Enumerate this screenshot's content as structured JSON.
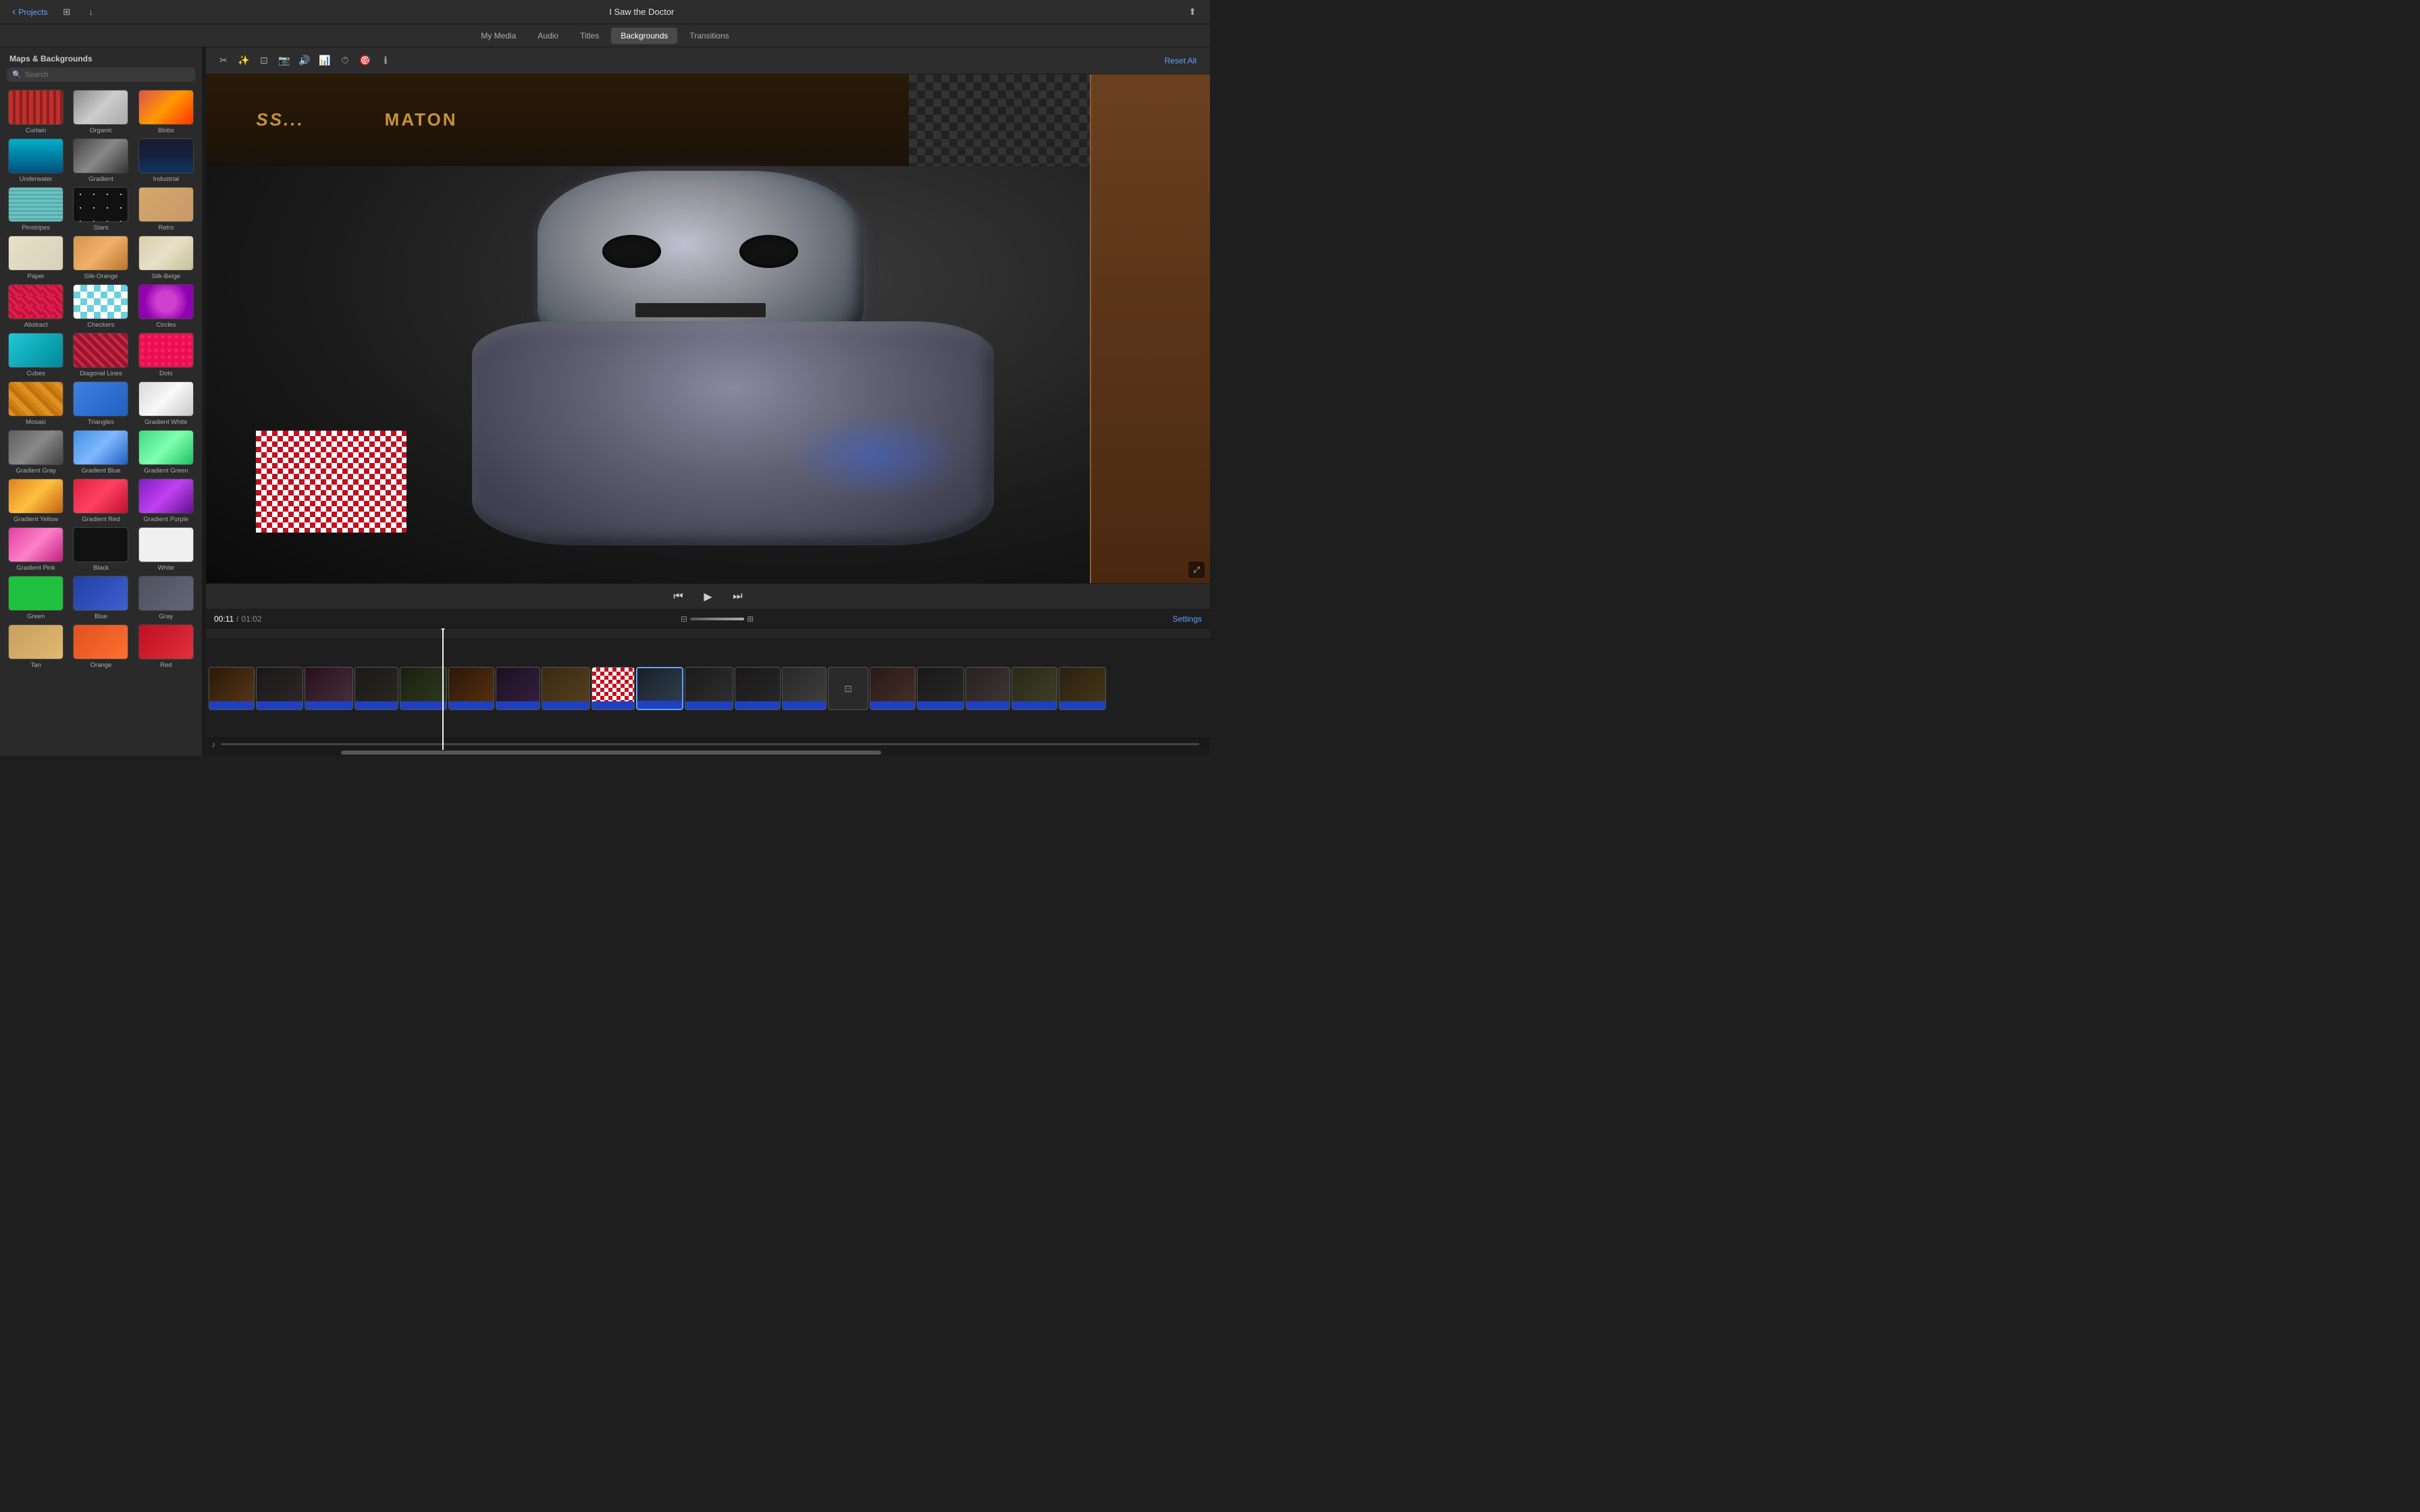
{
  "app": {
    "title": "I Saw the Doctor",
    "projects_label": "Projects"
  },
  "nav": {
    "tabs": [
      {
        "id": "my-media",
        "label": "My Media"
      },
      {
        "id": "audio",
        "label": "Audio"
      },
      {
        "id": "titles",
        "label": "Titles"
      },
      {
        "id": "backgrounds",
        "label": "Backgrounds"
      },
      {
        "id": "transitions",
        "label": "Transitions"
      }
    ],
    "active": "backgrounds"
  },
  "left_panel": {
    "title": "Maps & Backgrounds",
    "search": {
      "placeholder": "Search",
      "value": ""
    }
  },
  "backgrounds": [
    {
      "id": "curtain",
      "label": "Curtain",
      "class": "bg-curtain"
    },
    {
      "id": "organic",
      "label": "Organic",
      "class": "bg-organic"
    },
    {
      "id": "blobs",
      "label": "Blobs",
      "class": "bg-blobs"
    },
    {
      "id": "underwater",
      "label": "Underwater",
      "class": "bg-underwater"
    },
    {
      "id": "gradient",
      "label": "Gradient",
      "class": "bg-gradient"
    },
    {
      "id": "industrial",
      "label": "Industrial",
      "class": "bg-industrial"
    },
    {
      "id": "pinstripes",
      "label": "Pinstripes",
      "class": "bg-pinstripes"
    },
    {
      "id": "stars",
      "label": "Stars",
      "class": "bg-stars"
    },
    {
      "id": "retro",
      "label": "Retro",
      "class": "bg-retro"
    },
    {
      "id": "paper",
      "label": "Paper",
      "class": "bg-paper"
    },
    {
      "id": "silk-orange",
      "label": "Silk-Orange",
      "class": "bg-silk-orange"
    },
    {
      "id": "silk-beige",
      "label": "Silk-Beige",
      "class": "bg-silk-beige"
    },
    {
      "id": "abstract",
      "label": "Abstract",
      "class": "bg-abstract"
    },
    {
      "id": "checkers",
      "label": "Checkers",
      "class": "bg-checkers"
    },
    {
      "id": "circles",
      "label": "Circles",
      "class": "bg-circles"
    },
    {
      "id": "cubes",
      "label": "Cubes",
      "class": "bg-cubes-item"
    },
    {
      "id": "diagonal-lines",
      "label": "Diagonal Lines",
      "class": "bg-diagonal"
    },
    {
      "id": "dots",
      "label": "Dots",
      "class": "bg-dots"
    },
    {
      "id": "mosaic",
      "label": "Mosaic",
      "class": "bg-mosaic"
    },
    {
      "id": "triangles",
      "label": "Triangles",
      "class": "bg-triangles"
    },
    {
      "id": "gradient-white",
      "label": "Gradient White",
      "class": "bg-gradient-white"
    },
    {
      "id": "gradient-gray",
      "label": "Gradient Gray",
      "class": "bg-gradient-gray"
    },
    {
      "id": "gradient-blue",
      "label": "Gradient Blue",
      "class": "bg-gradient-blue"
    },
    {
      "id": "gradient-green",
      "label": "Gradient Green",
      "class": "bg-gradient-green"
    },
    {
      "id": "gradient-yellow",
      "label": "Gradient Yellow",
      "class": "bg-gradient-yellow"
    },
    {
      "id": "gradient-red",
      "label": "Gradient Red",
      "class": "bg-gradient-red"
    },
    {
      "id": "gradient-purple",
      "label": "Gradient Purple",
      "class": "bg-gradient-purple"
    },
    {
      "id": "gradient-pink",
      "label": "Gradient Pink",
      "class": "bg-gradient-pink"
    },
    {
      "id": "black",
      "label": "Black",
      "class": "bg-black"
    },
    {
      "id": "white",
      "label": "White",
      "class": "bg-white"
    },
    {
      "id": "green",
      "label": "Green",
      "class": "bg-green"
    },
    {
      "id": "blue",
      "label": "Blue",
      "class": "bg-blue"
    },
    {
      "id": "gray",
      "label": "Gray",
      "class": "bg-gray"
    },
    {
      "id": "tan",
      "label": "Tan",
      "class": "bg-tan"
    },
    {
      "id": "orange",
      "label": "Orange",
      "class": "bg-orange"
    },
    {
      "id": "red",
      "label": "Red",
      "class": "bg-red"
    }
  ],
  "toolbar": {
    "reset_label": "Reset All"
  },
  "player": {
    "time_current": "00:11",
    "time_separator": "/",
    "time_total": "01:02",
    "settings_label": "Settings"
  },
  "clips": [
    {
      "id": 1
    },
    {
      "id": 2
    },
    {
      "id": 3
    },
    {
      "id": 4
    },
    {
      "id": 5
    },
    {
      "id": 6
    },
    {
      "id": 7
    },
    {
      "id": 8
    },
    {
      "id": 9
    },
    {
      "id": 10
    },
    {
      "id": 11
    },
    {
      "id": 12
    },
    {
      "id": 13
    },
    {
      "id": 14
    },
    {
      "id": 15
    },
    {
      "id": 16
    },
    {
      "id": 17
    },
    {
      "id": 18
    }
  ]
}
